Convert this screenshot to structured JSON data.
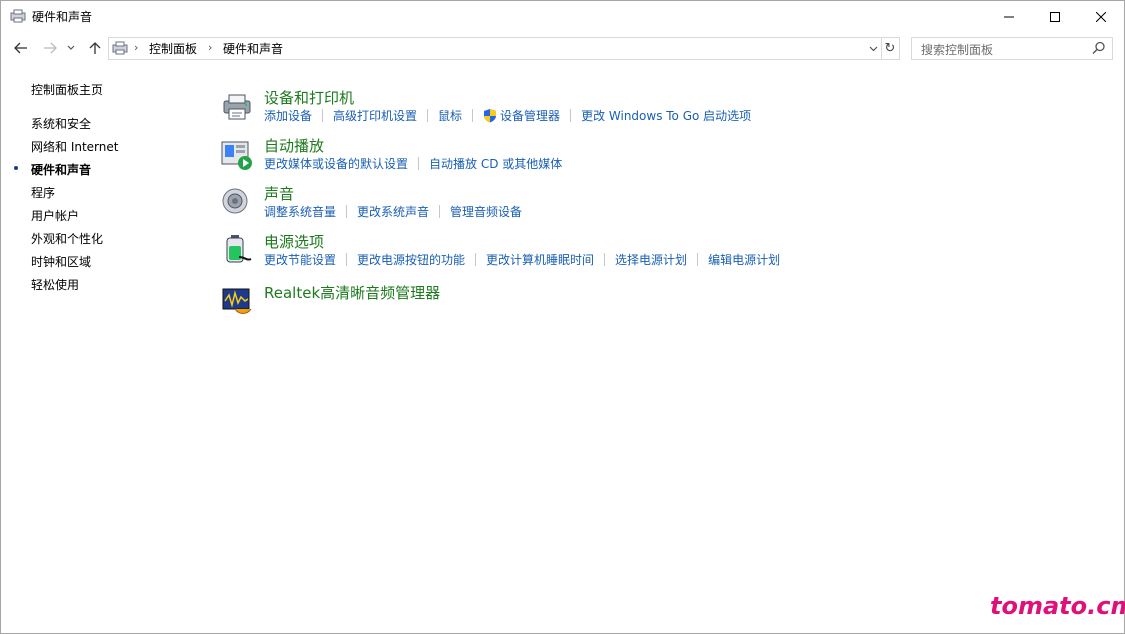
{
  "window": {
    "title": "硬件和声音"
  },
  "nav": {
    "breadcrumbs": [
      "控制面板",
      "硬件和声音"
    ],
    "search_placeholder": "搜索控制面板"
  },
  "sidebar": {
    "items": [
      {
        "label": "控制面板主页",
        "current": false
      },
      {
        "label": "系统和安全",
        "current": false
      },
      {
        "label": "网络和 Internet",
        "current": false
      },
      {
        "label": "硬件和声音",
        "current": true
      },
      {
        "label": "程序",
        "current": false
      },
      {
        "label": "用户帐户",
        "current": false
      },
      {
        "label": "外观和个性化",
        "current": false
      },
      {
        "label": "时钟和区域",
        "current": false
      },
      {
        "label": "轻松使用",
        "current": false
      }
    ]
  },
  "categories": [
    {
      "title": "设备和打印机",
      "icon": "printer-icon",
      "links": [
        "添加设备",
        "高级打印机设置",
        "鼠标",
        "设备管理器",
        "更改 Windows To Go 启动选项"
      ]
    },
    {
      "title": "自动播放",
      "icon": "autoplay-icon",
      "links": [
        "更改媒体或设备的默认设置",
        "自动播放 CD 或其他媒体"
      ]
    },
    {
      "title": "声音",
      "icon": "speaker-icon",
      "links": [
        "调整系统音量",
        "更改系统声音",
        "管理音频设备"
      ]
    },
    {
      "title": "电源选项",
      "icon": "battery-icon",
      "links": [
        "更改节能设置",
        "更改电源按钮的功能",
        "更改计算机睡眠时间",
        "选择电源计划",
        "编辑电源计划"
      ]
    },
    {
      "title": "Realtek高清晰音频管理器",
      "icon": "realtek-audio-icon",
      "links": []
    }
  ],
  "watermark": "tomato.cm",
  "colors": {
    "category_title": "#1e7a1e",
    "link": "#1a5fb4",
    "watermark": "#e0107a"
  }
}
